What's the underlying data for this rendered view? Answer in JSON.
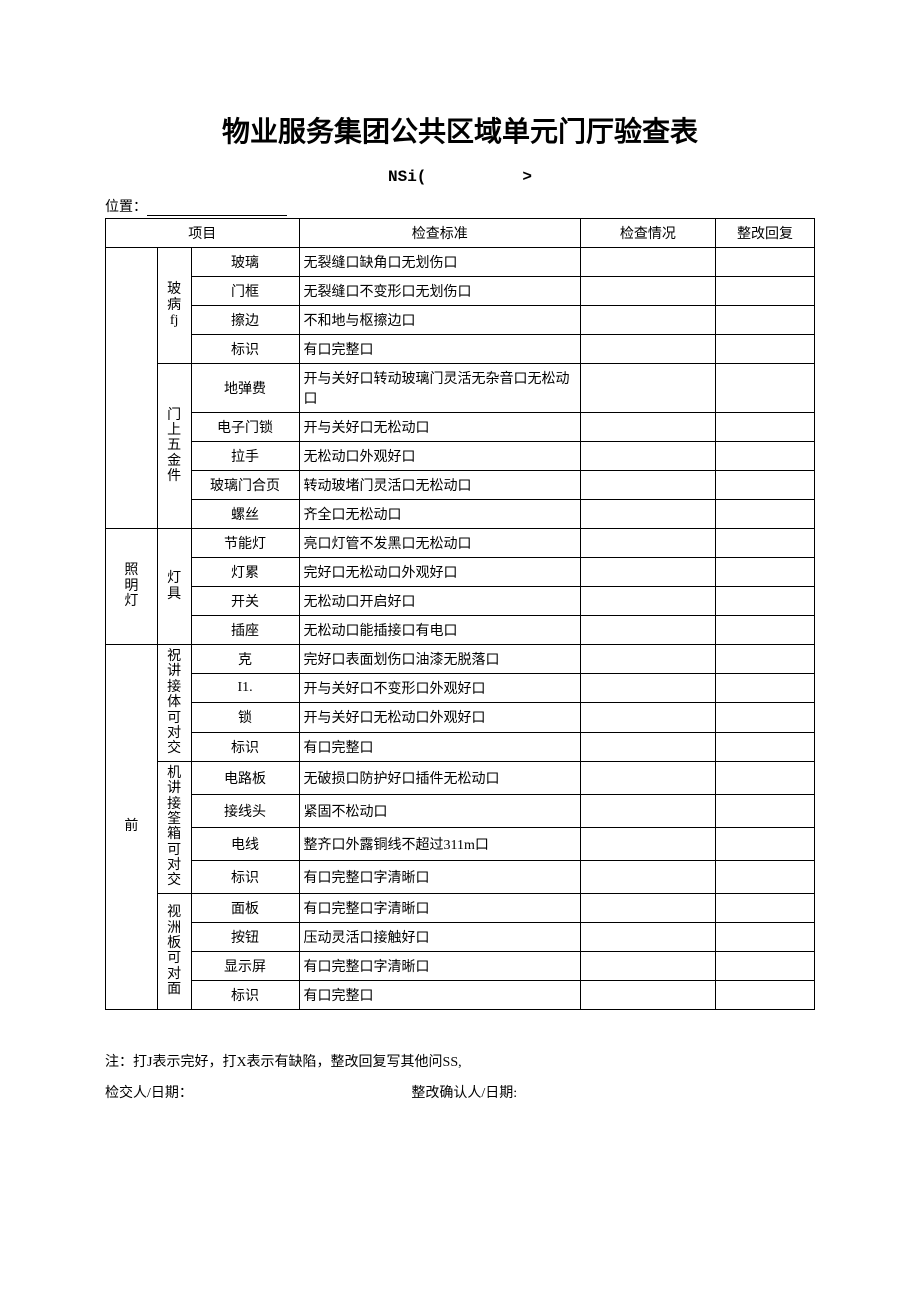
{
  "title": "物业服务集团公共区域单元门厅验查表",
  "subcode_left": "NSi(",
  "subcode_right": ">",
  "location_label": "位置：",
  "headers": {
    "project": "项目",
    "standard": "检查标准",
    "status": "检查情况",
    "reply": "整改回复"
  },
  "sections": [
    {
      "l1": "",
      "l2": "玻病fj",
      "rows": [
        {
          "item": "玻璃",
          "std": "无裂缝口缺角口无划伤口"
        },
        {
          "item": "门框",
          "std": "无裂缝口不变形口无划伤口"
        },
        {
          "item": "擦边",
          "std": "不和地与枢擦边口"
        },
        {
          "item": "标识",
          "std": "有口完整口"
        }
      ]
    },
    {
      "l1": "",
      "l2": "门上五金件",
      "rows": [
        {
          "item": "地弹费",
          "std": "开与关好口转动玻璃门灵活无杂音口无松动口"
        },
        {
          "item": "电子门锁",
          "std": "开与关好口无松动口"
        },
        {
          "item": "拉手",
          "std": "无松动口外观好口"
        },
        {
          "item": "玻璃门合页",
          "std": "转动玻堵门灵活口无松动口"
        },
        {
          "item": "螺丝",
          "std": "齐全口无松动口"
        }
      ]
    },
    {
      "l1": "照明灯",
      "l2": "灯具",
      "rows": [
        {
          "item": "节能灯",
          "std": "亮口灯管不发黑口无松动口"
        },
        {
          "item": "灯累",
          "std": "完好口无松动口外观好口"
        },
        {
          "item": "开关",
          "std": "无松动口开启好口"
        },
        {
          "item": "插座",
          "std": "无松动口能插接口有电口"
        }
      ]
    },
    {
      "l1": "前",
      "l2": "祝讲接体可对交",
      "rows": [
        {
          "item": "克",
          "std": "完好口表面划伤口油漆无脱落口"
        },
        {
          "item": "I1.",
          "std": "开与关好口不变形口外观好口"
        },
        {
          "item": "锁",
          "std": "开与关好口无松动口外观好口"
        },
        {
          "item": "标识",
          "std": "有口完整口"
        }
      ]
    },
    {
      "l1": "",
      "l2": "机讲接筌箱可对交",
      "rows": [
        {
          "item": "电路板",
          "std": "无破损口防护好口插件无松动口"
        },
        {
          "item": "接线头",
          "std": "紧固不松动口"
        },
        {
          "item": "电线",
          "std": "整齐口外露铜线不超过311m口"
        },
        {
          "item": "标识",
          "std": "有口完整口字清晰口"
        }
      ]
    },
    {
      "l1": "",
      "l2": "视洲板可对面",
      "rows": [
        {
          "item": "面板",
          "std": "有口完整口字清晰口"
        },
        {
          "item": "按钮",
          "std": "压动灵活口接触好口"
        },
        {
          "item": "显示屏",
          "std": "有口完整口字清晰口"
        },
        {
          "item": "标识",
          "std": "有口完整口"
        }
      ]
    }
  ],
  "note": "注：打J表示完好，打X表示有缺陷，整改回复写其他问SS,",
  "sign_left": "检交人/日期：",
  "sign_right": "整改确认人/日期:"
}
